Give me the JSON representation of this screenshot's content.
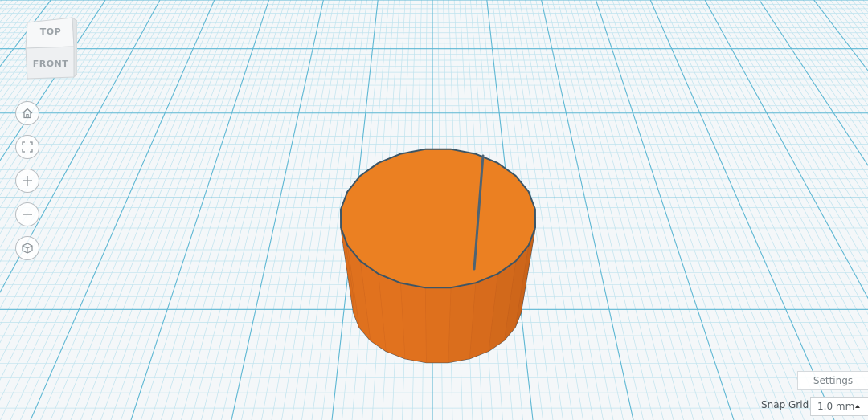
{
  "viewcube": {
    "top_label": "TOP",
    "front_label": "FRONT"
  },
  "nav": {
    "home_icon": "home-icon",
    "fit_icon": "fit-view-icon",
    "zoom_in_icon": "plus-icon",
    "zoom_out_icon": "minus-icon",
    "projection_icon": "cube-icon"
  },
  "settings": {
    "label": "Settings"
  },
  "snap_grid": {
    "label": "Snap Grid",
    "value": "1.0 mm"
  },
  "colors": {
    "workplane_bg": "#f4f7f9",
    "grid_minor": "#bfe3ee",
    "grid_major": "#5db7d3",
    "shape_top": "#eb8022",
    "shape_side": "#c9651a",
    "shape_edge": "#3c5566"
  }
}
